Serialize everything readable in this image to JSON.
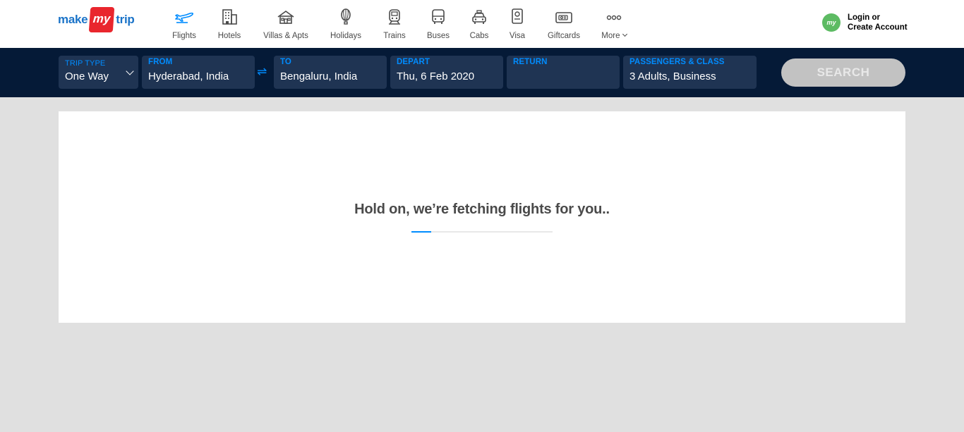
{
  "brand": {
    "make": "make",
    "my": "my",
    "trip": "trip"
  },
  "nav": [
    {
      "label": "Flights",
      "icon": "plane-icon",
      "active": true
    },
    {
      "label": "Hotels",
      "icon": "hotel-icon"
    },
    {
      "label": "Villas & Apts",
      "icon": "villa-icon"
    },
    {
      "label": "Holidays",
      "icon": "balloon-icon"
    },
    {
      "label": "Trains",
      "icon": "train-icon"
    },
    {
      "label": "Buses",
      "icon": "bus-icon"
    },
    {
      "label": "Cabs",
      "icon": "cab-icon"
    },
    {
      "label": "Visa",
      "icon": "passport-icon"
    },
    {
      "label": "Giftcards",
      "icon": "giftcard-icon"
    },
    {
      "label": "More",
      "icon": "more-dots-icon"
    }
  ],
  "login": {
    "badge": "my",
    "line1": "Login or",
    "line2": "Create Account"
  },
  "search": {
    "trip_type": {
      "label": "TRIP TYPE",
      "value": "One Way"
    },
    "from": {
      "label": "FROM",
      "value": "Hyderabad, India"
    },
    "to": {
      "label": "TO",
      "value": "Bengaluru, India"
    },
    "depart": {
      "label": "DEPART",
      "value": "Thu, 6 Feb 2020"
    },
    "return": {
      "label": "RETURN",
      "value": ""
    },
    "passengers": {
      "label": "PASSENGERS & CLASS",
      "value": "3 Adults, Business"
    },
    "swap_icon": "⇌",
    "button": "SEARCH"
  },
  "loading": {
    "message": "Hold on, we’re fetching flights for you..",
    "progress": 0.14
  },
  "colors": {
    "accent": "#008cff",
    "bar": "#051a37",
    "field": "#1f3453",
    "brand_red": "#e9262d"
  }
}
